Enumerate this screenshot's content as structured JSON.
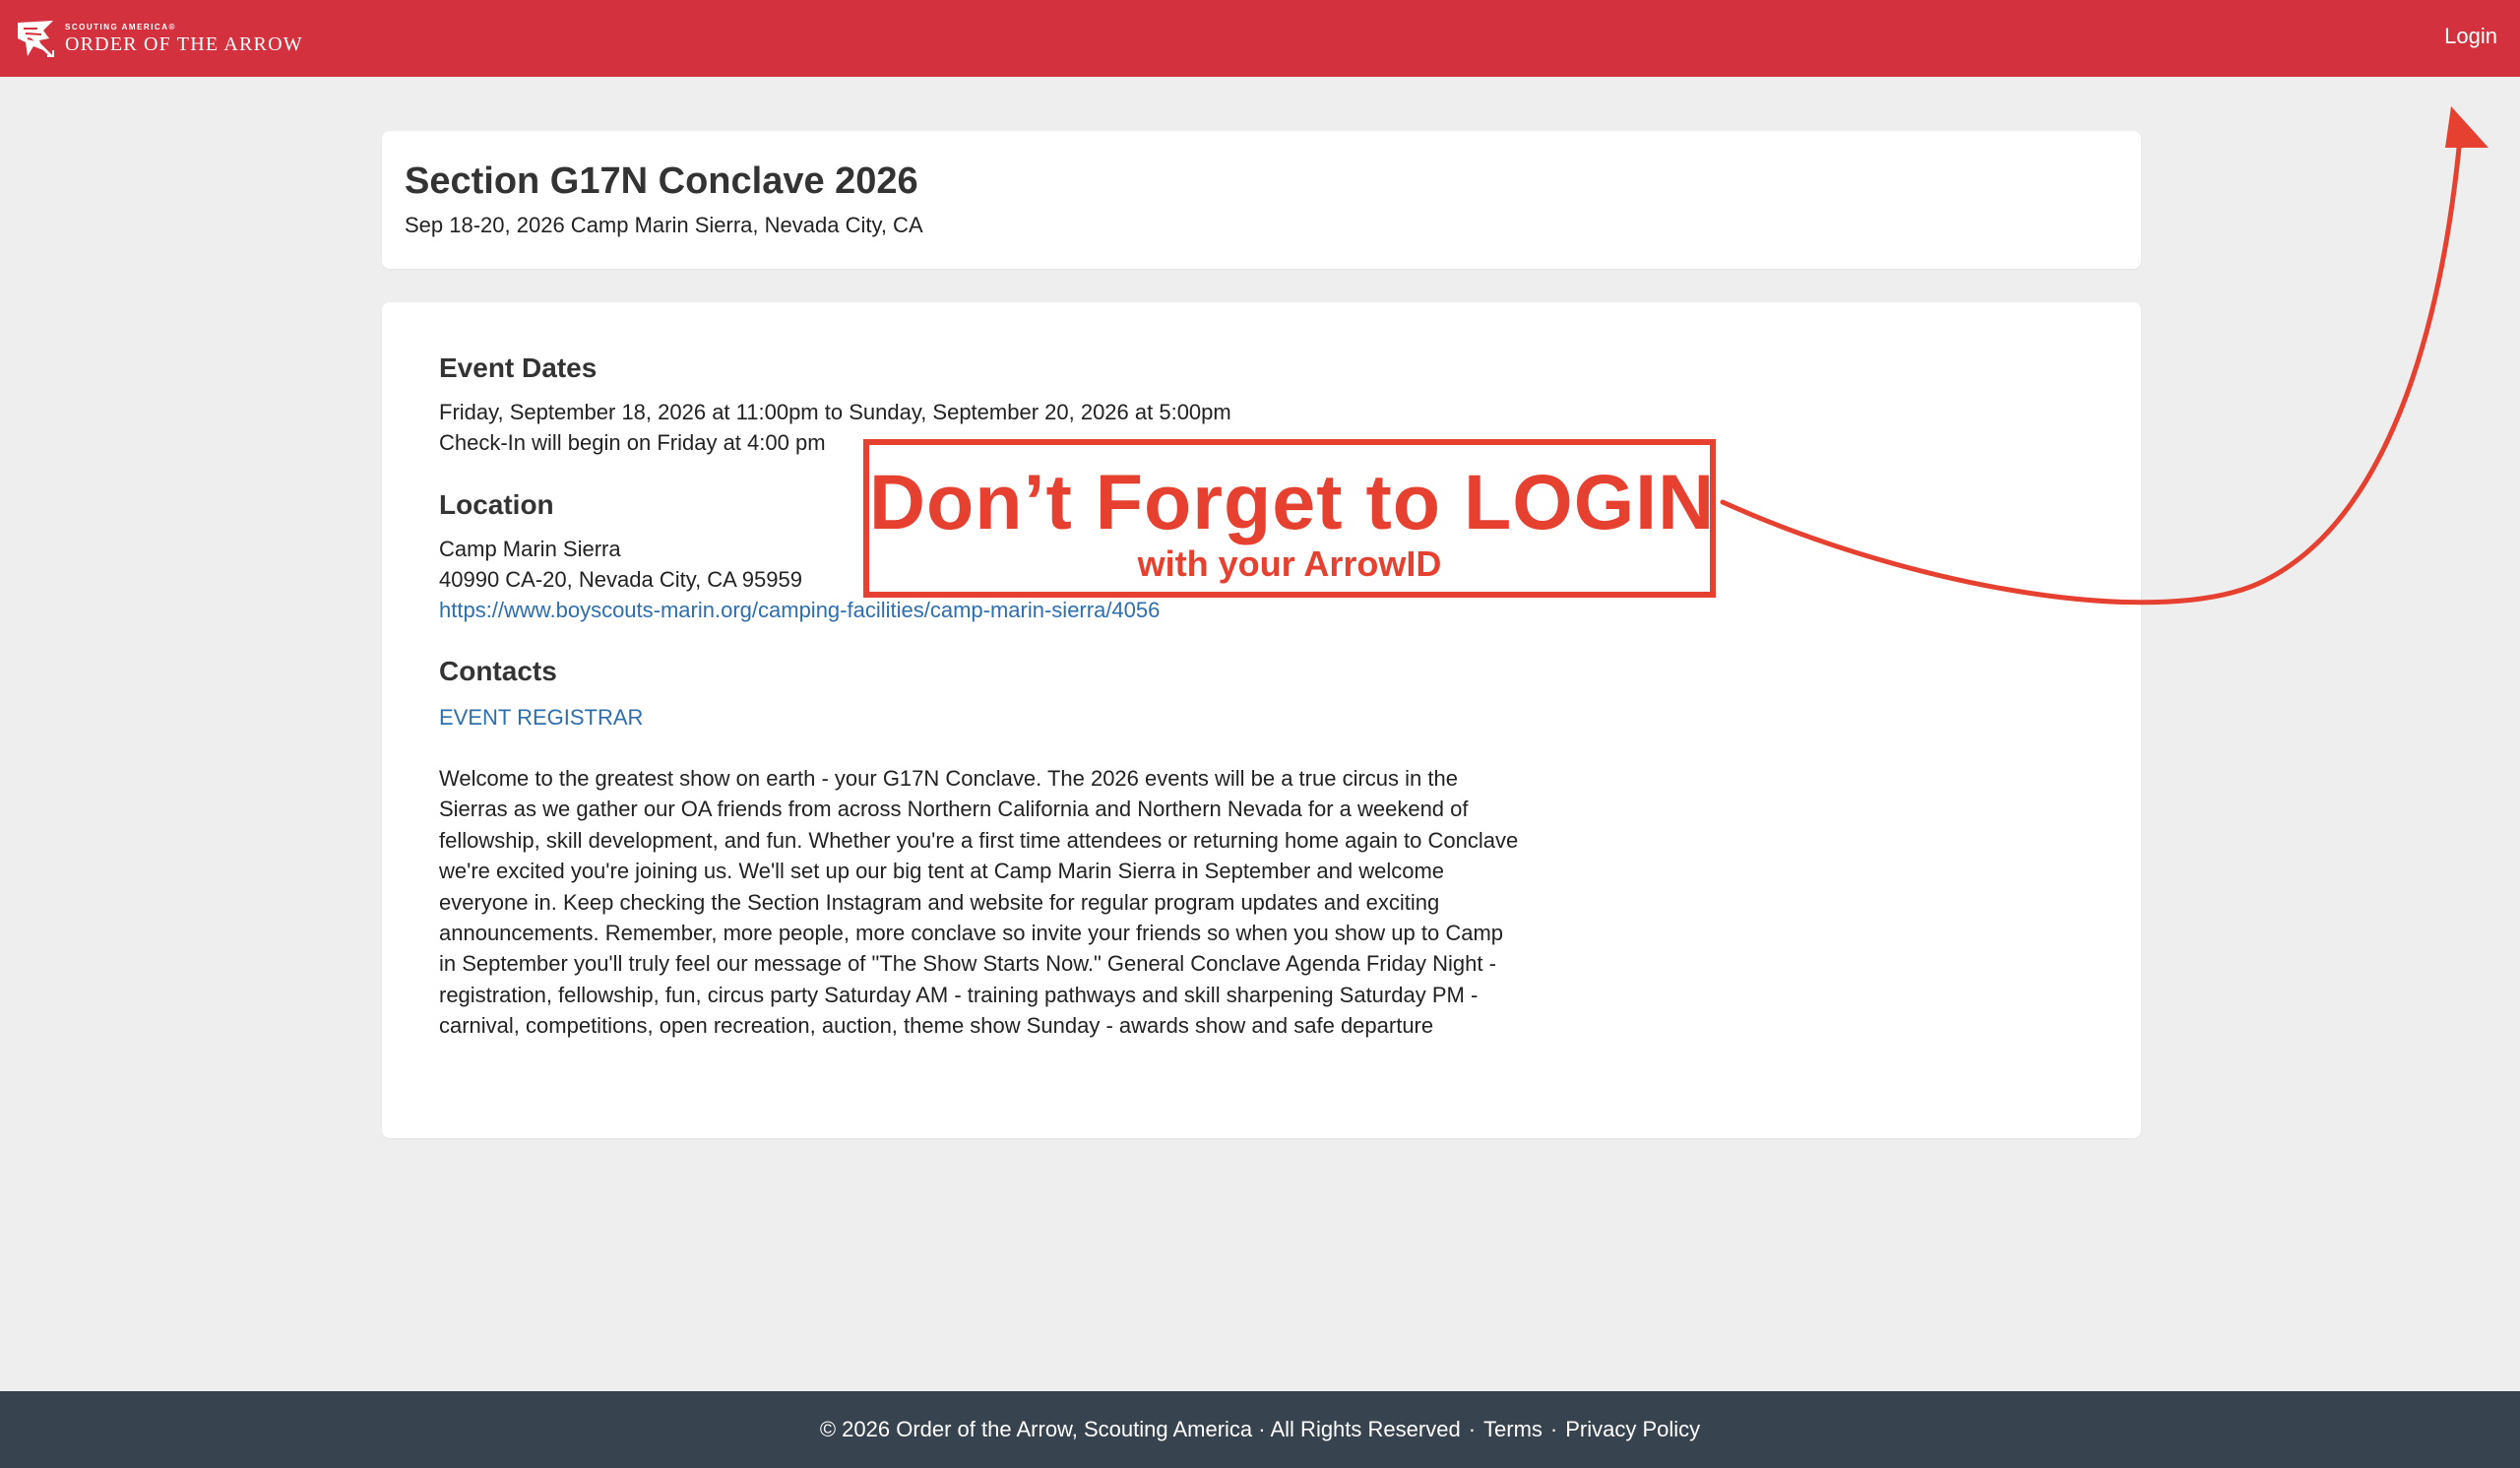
{
  "nav": {
    "brand_sub": "SCOUTING AMERICA®",
    "brand_main": "ORDER OF THE ARROW",
    "login": "Login"
  },
  "event": {
    "title": "Section G17N Conclave 2026",
    "subtitle": "Sep 18-20, 2026 Camp Marin Sierra, Nevada City, CA"
  },
  "details": {
    "dates_heading": "Event Dates",
    "dates_line1": "Friday, September 18, 2026 at 11:00pm to Sunday, September 20, 2026 at 5:00pm",
    "dates_line2": "Check-In will begin on Friday at 4:00 pm",
    "location_heading": "Location",
    "location_name": "Camp Marin Sierra",
    "location_address": "40990 CA-20, Nevada City, CA 95959",
    "location_url": "https://www.boyscouts-marin.org/camping-facilities/camp-marin-sierra/4056",
    "contacts_heading": "Contacts",
    "contact_link": "EVENT REGISTRAR",
    "description": "Welcome to the greatest show on earth - your G17N Conclave. The 2026 events will be a true circus in the Sierras as we gather our OA friends from across Northern California and Northern Nevada for a weekend of fellowship, skill development, and fun. Whether you're a first time attendees or returning home again to Conclave we're excited you're joining us. We'll set up our big tent at Camp Marin Sierra in September and welcome everyone in. Keep checking the Section Instagram and website for regular program updates and exciting announcements. Remember, more people, more conclave so invite your friends so when you show up to Camp in September you'll truly feel our message of \"The Show Starts Now.\" General Conclave Agenda Friday Night - registration, fellowship, fun, circus party Saturday AM - training pathways and skill sharpening Saturday PM - carnival, competitions, open recreation, auction, theme show Sunday - awards show and safe departure"
  },
  "annotation": {
    "main": "Don’t Forget to LOGIN",
    "sub": "with your ArrowID",
    "color": "#e64030"
  },
  "footer": {
    "copyright": "© 2026 Order of the Arrow, Scouting America · All Rights Reserved",
    "terms": "Terms",
    "privacy": "Privacy Policy"
  },
  "colors": {
    "navbar": "#d2313d",
    "footer": "#37434e",
    "link": "#2d6eaf",
    "background": "#eeeeee"
  }
}
